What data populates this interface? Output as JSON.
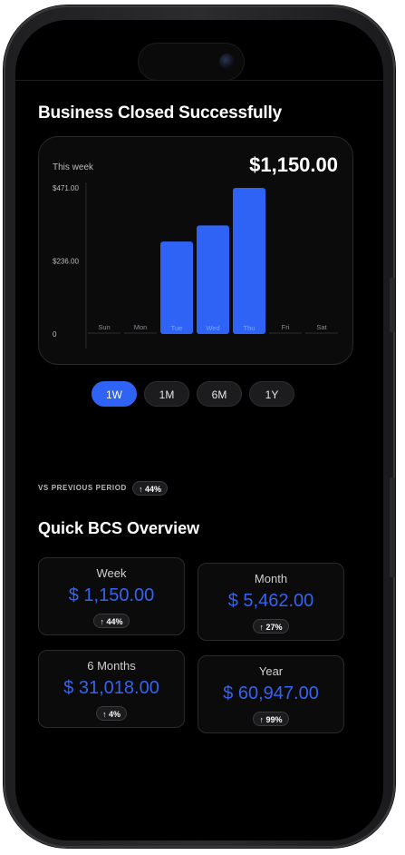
{
  "header": {
    "title": "Business Closed Successfully"
  },
  "chart_card": {
    "period_label": "This week",
    "total": "$1,150.00"
  },
  "chart_data": {
    "type": "bar",
    "categories": [
      "Sun",
      "Mon",
      "Tue",
      "Wed",
      "Thu",
      "Fri",
      "Sat"
    ],
    "values": [
      0,
      0,
      298,
      350,
      471,
      0,
      0
    ],
    "y_tick_labels": [
      "$471.00",
      "$236.00",
      "0"
    ],
    "y_ticks": [
      471,
      236,
      0
    ],
    "ylim": [
      0,
      471
    ],
    "grid": false,
    "bar_color": "#2f63f5",
    "active_label_color": "#7da2ff",
    "inactive_label_color": "#8e8e93"
  },
  "range_selector": {
    "options": [
      "1W",
      "1M",
      "6M",
      "1Y"
    ],
    "active": "1W"
  },
  "comparison": {
    "label": "VS PREVIOUS PERIOD",
    "change": "↑ 44%"
  },
  "overview": {
    "title": "Quick BCS Overview",
    "cards": [
      {
        "label": "Week",
        "value": "$ 1,150.00",
        "change": "↑ 44%"
      },
      {
        "label": "Month",
        "value": "$ 5,462.00",
        "change": "↑ 27%"
      },
      {
        "label": "6 Months",
        "value": "$ 31,018.00",
        "change": "↑ 4%"
      },
      {
        "label": "Year",
        "value": "$ 60,947.00",
        "change": "↑ 99%"
      }
    ]
  },
  "colors": {
    "accent": "#2f63f5",
    "value_text": "#3563f0",
    "background": "#000000"
  }
}
